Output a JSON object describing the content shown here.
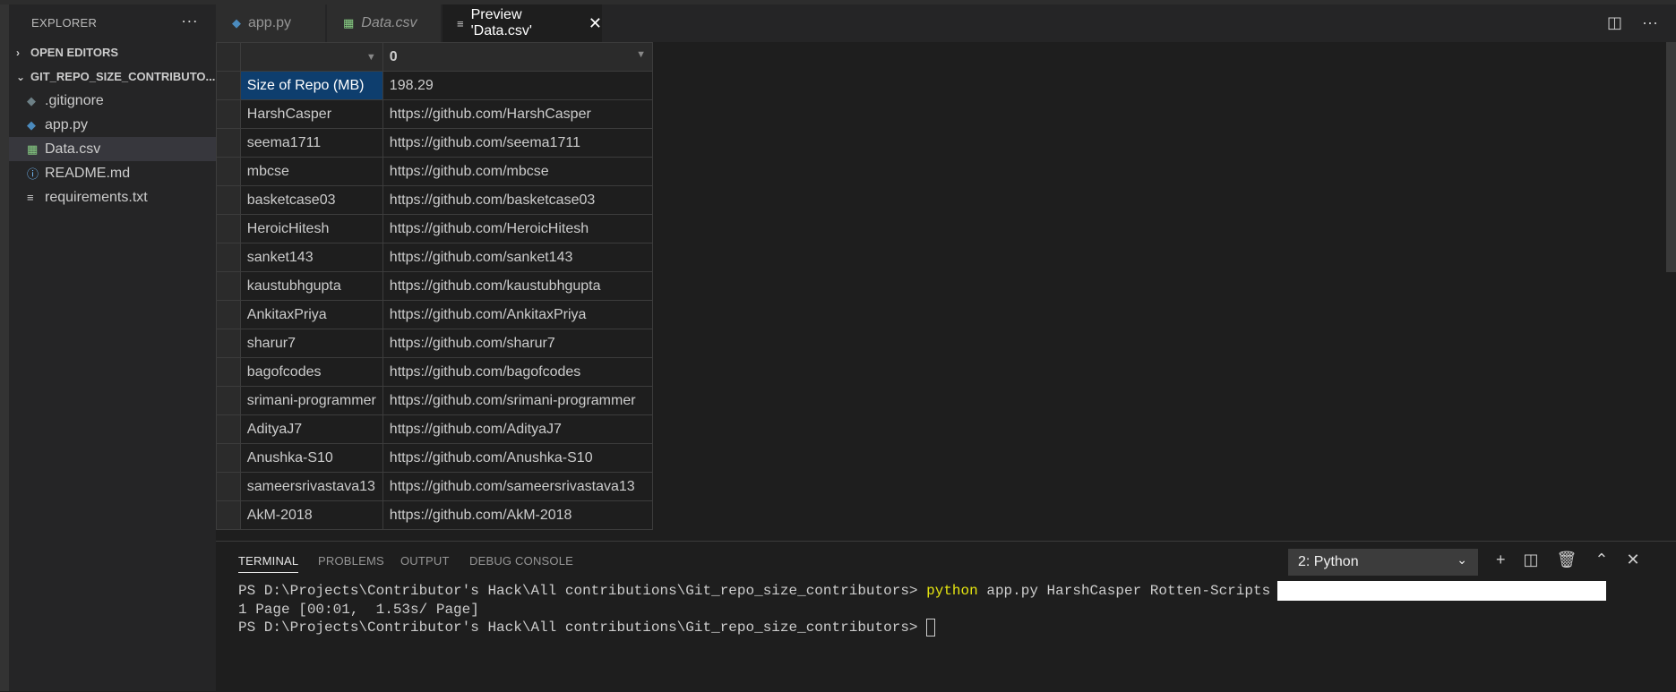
{
  "sidebar": {
    "title": "EXPLORER",
    "more": "···",
    "open_editors": "OPEN EDITORS",
    "folder": "GIT_REPO_SIZE_CONTRIBUTO...",
    "files": [
      {
        "name": ".gitignore",
        "icon": "◆",
        "color": "#6d8086"
      },
      {
        "name": "app.py",
        "icon": "◆",
        "color": "#4b8bbe"
      },
      {
        "name": "Data.csv",
        "icon": "▦",
        "color": "#89d185"
      },
      {
        "name": "README.md",
        "icon": "ⓘ",
        "color": "#75beff"
      },
      {
        "name": "requirements.txt",
        "icon": "≡",
        "color": "#cccccc"
      }
    ]
  },
  "tabs": [
    {
      "label": "app.py",
      "icon": "◆"
    },
    {
      "label": "Data.csv",
      "icon": "▦"
    },
    {
      "label": "Preview 'Data.csv'",
      "icon": "≡",
      "close": "✕"
    }
  ],
  "editor_actions": {
    "split": "◫",
    "more": "···"
  },
  "grid": {
    "col0": "",
    "col1": "0",
    "rows": [
      [
        "Size of Repo (MB)",
        "198.29"
      ],
      [
        "HarshCasper",
        "https://github.com/HarshCasper"
      ],
      [
        "seema1711",
        "https://github.com/seema1711"
      ],
      [
        "mbcse",
        "https://github.com/mbcse"
      ],
      [
        "basketcase03",
        "https://github.com/basketcase03"
      ],
      [
        "HeroicHitesh",
        "https://github.com/HeroicHitesh"
      ],
      [
        "sanket143",
        "https://github.com/sanket143"
      ],
      [
        "kaustubhgupta",
        "https://github.com/kaustubhgupta"
      ],
      [
        "AnkitaxPriya",
        "https://github.com/AnkitaxPriya"
      ],
      [
        "sharur7",
        "https://github.com/sharur7"
      ],
      [
        "bagofcodes",
        "https://github.com/bagofcodes"
      ],
      [
        "srimani-programmer",
        "https://github.com/srimani-programmer"
      ],
      [
        "AdityaJ7",
        "https://github.com/AdityaJ7"
      ],
      [
        "Anushka-S10",
        "https://github.com/Anushka-S10"
      ],
      [
        "sameersrivastava13",
        "https://github.com/sameersrivastava13"
      ],
      [
        "AkM-2018",
        "https://github.com/AkM-2018"
      ]
    ]
  },
  "panel": {
    "tabs": [
      "TERMINAL",
      "PROBLEMS",
      "OUTPUT",
      "DEBUG CONSOLE"
    ],
    "terminal_select": "2: Python",
    "actions": {
      "add": "+",
      "split": "◫",
      "trash": "🗑",
      "maximize": "⌃",
      "close": "✕"
    },
    "lines": {
      "prompt1": "PS D:\\Projects\\Contributor's Hack\\All contributions\\Git_repo_size_contributors> ",
      "cmd": "python",
      "args": " app.py HarshCasper Rotten-Scripts",
      "progress": "1 Page [00:01,  1.53s/ Page]",
      "prompt2": "PS D:\\Projects\\Contributor's Hack\\All contributions\\Git_repo_size_contributors> "
    }
  }
}
